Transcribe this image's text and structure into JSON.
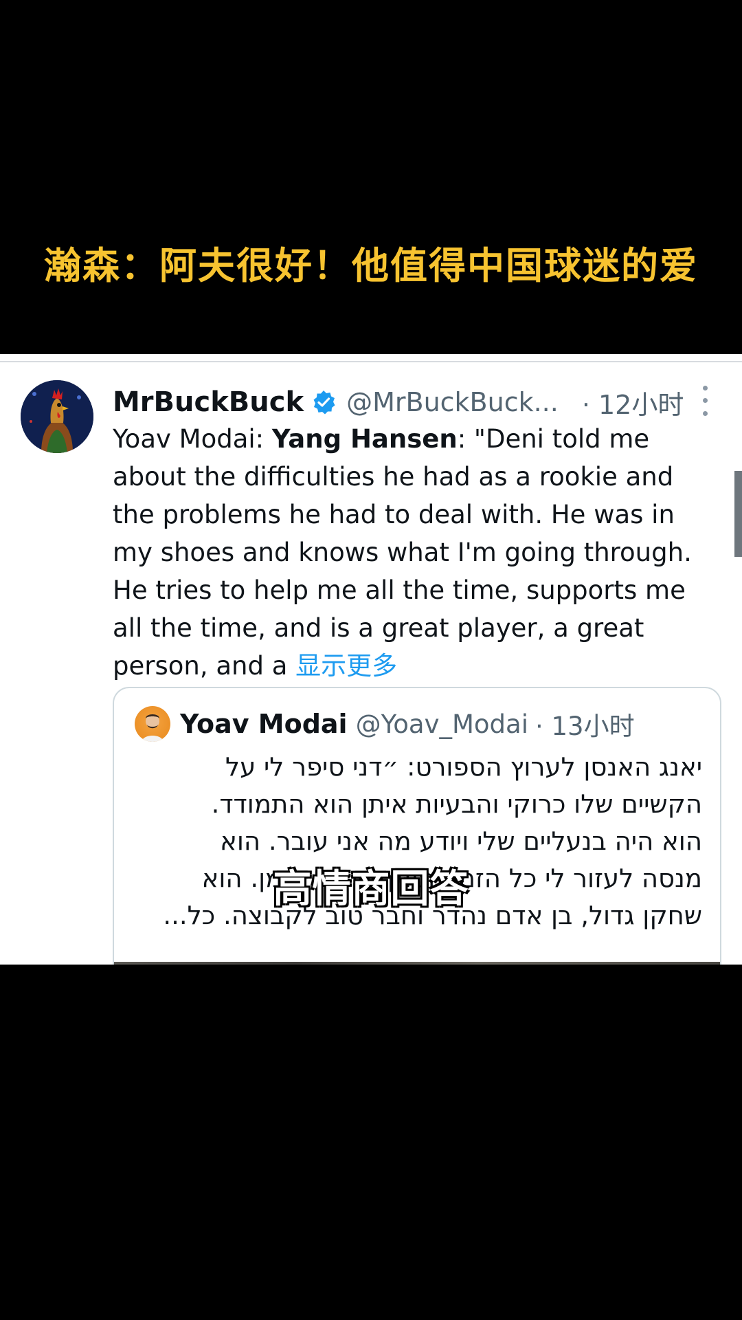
{
  "video": {
    "title": "瀚森：阿夫很好！他值得中国球迷的爱",
    "caption": "高情商回答",
    "title_color": "#f7c330"
  },
  "tweet": {
    "display_name": "MrBuckBuck",
    "verified": true,
    "handle": "@MrBuckBuck...",
    "time": "· 12小时",
    "avatar_icon": "rooster-avatar",
    "more_icon": "vertical-ellipsis-icon",
    "body_prefix": "Yoav Modai: ",
    "body_bold": "Yang Hansen",
    "body_rest": ": \"Deni told me about the difficulties he had as a rookie and the problems he had to deal with. He was in my shoes and knows what I'm going through. He tries to help me all the time, supports me all the time, and is a great player, a great person, and a ",
    "show_more": "显示更多",
    "link_color": "#1d9bf0"
  },
  "quote": {
    "display_name": "Yoav Modai",
    "handle": "@Yoav_Modai",
    "time": "· 13小时",
    "lines": [
      "יאנג האנסן לערוץ הספורט: ״דני סיפר לי על",
      "הקשיים שלו כרוקי והבעיות איתן הוא התמודד.",
      "הוא היה בנעליים שלי ויודע מה אני עובר. הוא",
      "מנסה לעזור לי כל הזמן, תומך בי כל הזמן. הוא",
      "שחקן גדול, בן אדם נהדר וחבר טוב לקבוצה. כל..."
    ]
  }
}
